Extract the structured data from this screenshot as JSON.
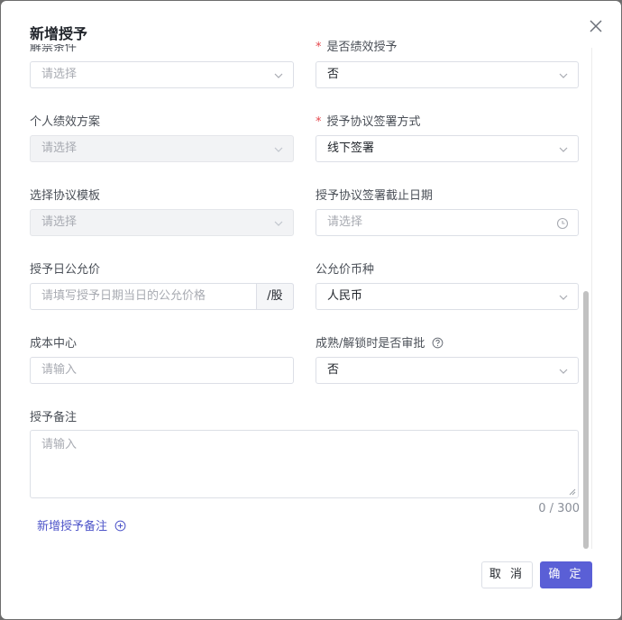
{
  "dialog": {
    "title": "新增授予",
    "fields": {
      "unlock_condition": {
        "label": "解禁条件",
        "placeholder": "请选择"
      },
      "performance_grant": {
        "label": "是否绩效授予",
        "value": "否",
        "required": true
      },
      "personal_perf_plan": {
        "label": "个人绩效方案",
        "placeholder": "请选择"
      },
      "agreement_sign_method": {
        "label": "授予协议签署方式",
        "value": "线下签署",
        "required": true
      },
      "agreement_template": {
        "label": "选择协议模板",
        "placeholder": "请选择"
      },
      "agreement_deadline": {
        "label": "授予协议签署截止日期",
        "placeholder": "请选择"
      },
      "grant_fair_price": {
        "label": "授予日公允价",
        "placeholder": "请填写授予日期当日的公允价格",
        "suffix": "/股"
      },
      "fair_price_currency": {
        "label": "公允价币种",
        "value": "人民币"
      },
      "cost_center": {
        "label": "成本中心",
        "placeholder": "请输入"
      },
      "vest_unlock_approval": {
        "label": "成熟/解锁时是否审批",
        "value": "否"
      },
      "grant_remark": {
        "label": "授予备注",
        "placeholder": "请输入",
        "counter": "0 / 300"
      }
    },
    "add_remark_link": "新增授予备注",
    "buttons": {
      "cancel": "取 消",
      "confirm": "确 定"
    }
  }
}
